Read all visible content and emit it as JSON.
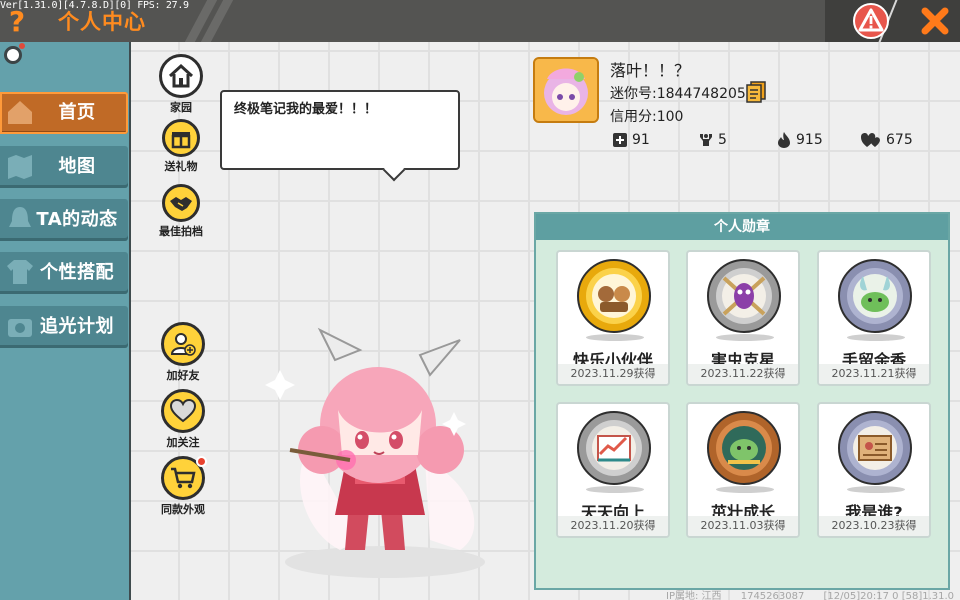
{
  "version_text": "Ver[1.31.0][4.7.8.D][0] FPS: 27.9",
  "title": "个人中心",
  "colors": {
    "accent": "#ff8b1f",
    "sidebar": "#64a1ab",
    "active_tab": "#c06a26",
    "panel": "#d4ebdd",
    "panel_head": "#5e9fa1",
    "warning": "#e8564c"
  },
  "icons": {
    "help": "question-mark-icon",
    "warning": "warning-icon",
    "close": "close-x-icon"
  },
  "sidebar": {
    "items": [
      {
        "label": "首页",
        "icon": "home-tile-icon",
        "active": true
      },
      {
        "label": "地图",
        "icon": "map-tile-icon",
        "active": false
      },
      {
        "label": "TA的动态",
        "icon": "bell-tile-icon",
        "active": false
      },
      {
        "label": "个性搭配",
        "icon": "outfit-tile-icon",
        "active": false
      },
      {
        "label": "追光计划",
        "icon": "camera-tile-icon",
        "active": false
      }
    ]
  },
  "actions": {
    "top": [
      {
        "label": "家园",
        "icon": "house-icon"
      },
      {
        "label": "送礼物",
        "icon": "gift-icon"
      },
      {
        "label": "最佳拍档",
        "icon": "handshake-icon"
      }
    ],
    "bottom": [
      {
        "label": "加好友",
        "icon": "add-friend-icon"
      },
      {
        "label": "加关注",
        "icon": "heart-icon"
      },
      {
        "label": "同款外观",
        "icon": "cart-icon",
        "badge": true
      }
    ]
  },
  "bubble": {
    "text": "终极笔记我的最爱！！！"
  },
  "profile": {
    "nickname": "落叶！！？",
    "mini_id": "迷你号:1844748205",
    "credit": "信用分:100",
    "stats": [
      {
        "icon": "plus-square-icon",
        "value": "91"
      },
      {
        "icon": "trophy-person-icon",
        "value": "5"
      },
      {
        "icon": "flame-icon",
        "value": "915"
      },
      {
        "icon": "hearts-icon",
        "value": "675"
      }
    ]
  },
  "medals": {
    "title": "个人勋章",
    "items": [
      {
        "name": "快乐小伙伴",
        "date": "2023.11.29获得",
        "tier": "gold"
      },
      {
        "name": "害虫克星",
        "date": "2023.11.22获得",
        "tier": "silver"
      },
      {
        "name": "手留余香",
        "date": "2023.11.21获得",
        "tier": "blue"
      },
      {
        "name": "天天向上",
        "date": "2023.11.20获得",
        "tier": "silver"
      },
      {
        "name": "茁壮成长",
        "date": "2023.11.03获得",
        "tier": "bronze"
      },
      {
        "name": "我是谁?",
        "date": "2023.10.23获得",
        "tier": "blue"
      }
    ]
  },
  "footer": {
    "ip": "IP属地: 江西",
    "uid": "1745263087",
    "info": "[12/05]20:17 0 [58]1.31.0"
  }
}
